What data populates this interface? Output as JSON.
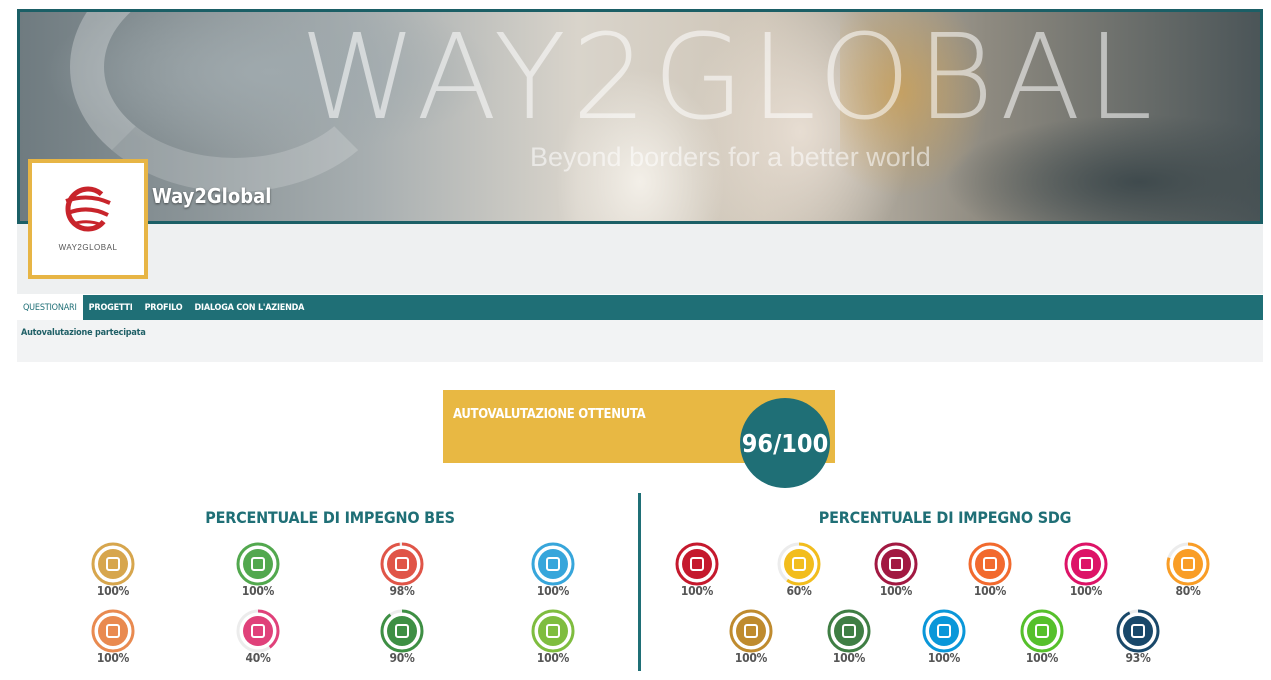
{
  "header": {
    "watermark_title": "WAY2GLOBAL",
    "watermark_subtitle": "Beyond borders for a better world",
    "company_name": "Way2Global",
    "logo_text": "WAY2GLOBAL",
    "accent": "#1f6f76",
    "gold": "#e8b843"
  },
  "nav": {
    "items": [
      {
        "label": "QUESTIONARI",
        "active": true
      },
      {
        "label": "PROGETTI",
        "active": false
      },
      {
        "label": "PROFILO",
        "active": false
      },
      {
        "label": "DIALOGA CON L'AZIENDA",
        "active": false
      }
    ],
    "sub_item": "Autovalutazione partecipata"
  },
  "score": {
    "title": "AUTOVALUTAZIONE OTTENUTA",
    "value": "96/100"
  },
  "bes": {
    "title": "PERCENTUALE DI IMPEGNO BES",
    "items": [
      {
        "icon": "education-icon",
        "color": "#d7a64d",
        "value": 100,
        "label": "100%"
      },
      {
        "icon": "work-life-icon",
        "color": "#52a84e",
        "value": 100,
        "label": "100%"
      },
      {
        "icon": "well-being-icon",
        "color": "#e05548",
        "value": 98,
        "label": "98%"
      },
      {
        "icon": "social-relations-icon",
        "color": "#37a6db",
        "value": 100,
        "label": "100%"
      },
      {
        "icon": "economic-wellbeing-icon",
        "color": "#e98a50",
        "value": 100,
        "label": "100%"
      },
      {
        "icon": "heritage-icon",
        "color": "#e0417a",
        "value": 40,
        "label": "40%"
      },
      {
        "icon": "environment-icon",
        "color": "#3e8f44",
        "value": 90,
        "label": "90%"
      },
      {
        "icon": "research-icon",
        "color": "#7fbd3f",
        "value": 100,
        "label": "100%"
      }
    ]
  },
  "sdg": {
    "title": "PERCENTUALE DI IMPEGNO SDG",
    "items": [
      {
        "icon": "sdg-no-poverty-icon",
        "color": "#c5192d",
        "value": 100,
        "label": "100%"
      },
      {
        "icon": "sdg-clean-energy-icon",
        "color": "#f2bd1d",
        "value": 60,
        "label": "60%"
      },
      {
        "icon": "sdg-decent-work-icon",
        "color": "#a21942",
        "value": 100,
        "label": "100%"
      },
      {
        "icon": "sdg-industry-icon",
        "color": "#f26a2e",
        "value": 100,
        "label": "100%"
      },
      {
        "icon": "sdg-reduced-inequalities-icon",
        "color": "#dd1367",
        "value": 100,
        "label": "100%"
      },
      {
        "icon": "sdg-sustainable-cities-icon",
        "color": "#f99d26",
        "value": 80,
        "label": "80%"
      },
      {
        "icon": "sdg-responsible-consumption-icon",
        "color": "#bf8b2e",
        "value": 100,
        "label": "100%"
      },
      {
        "icon": "sdg-climate-action-icon",
        "color": "#3f7e44",
        "value": 100,
        "label": "100%"
      },
      {
        "icon": "sdg-life-below-water-icon",
        "color": "#0a97d9",
        "value": 100,
        "label": "100%"
      },
      {
        "icon": "sdg-life-on-land-icon",
        "color": "#56c02b",
        "value": 100,
        "label": "100%"
      },
      {
        "icon": "sdg-peace-justice-icon",
        "color": "#19486a",
        "value": 93,
        "label": "93%"
      }
    ]
  }
}
